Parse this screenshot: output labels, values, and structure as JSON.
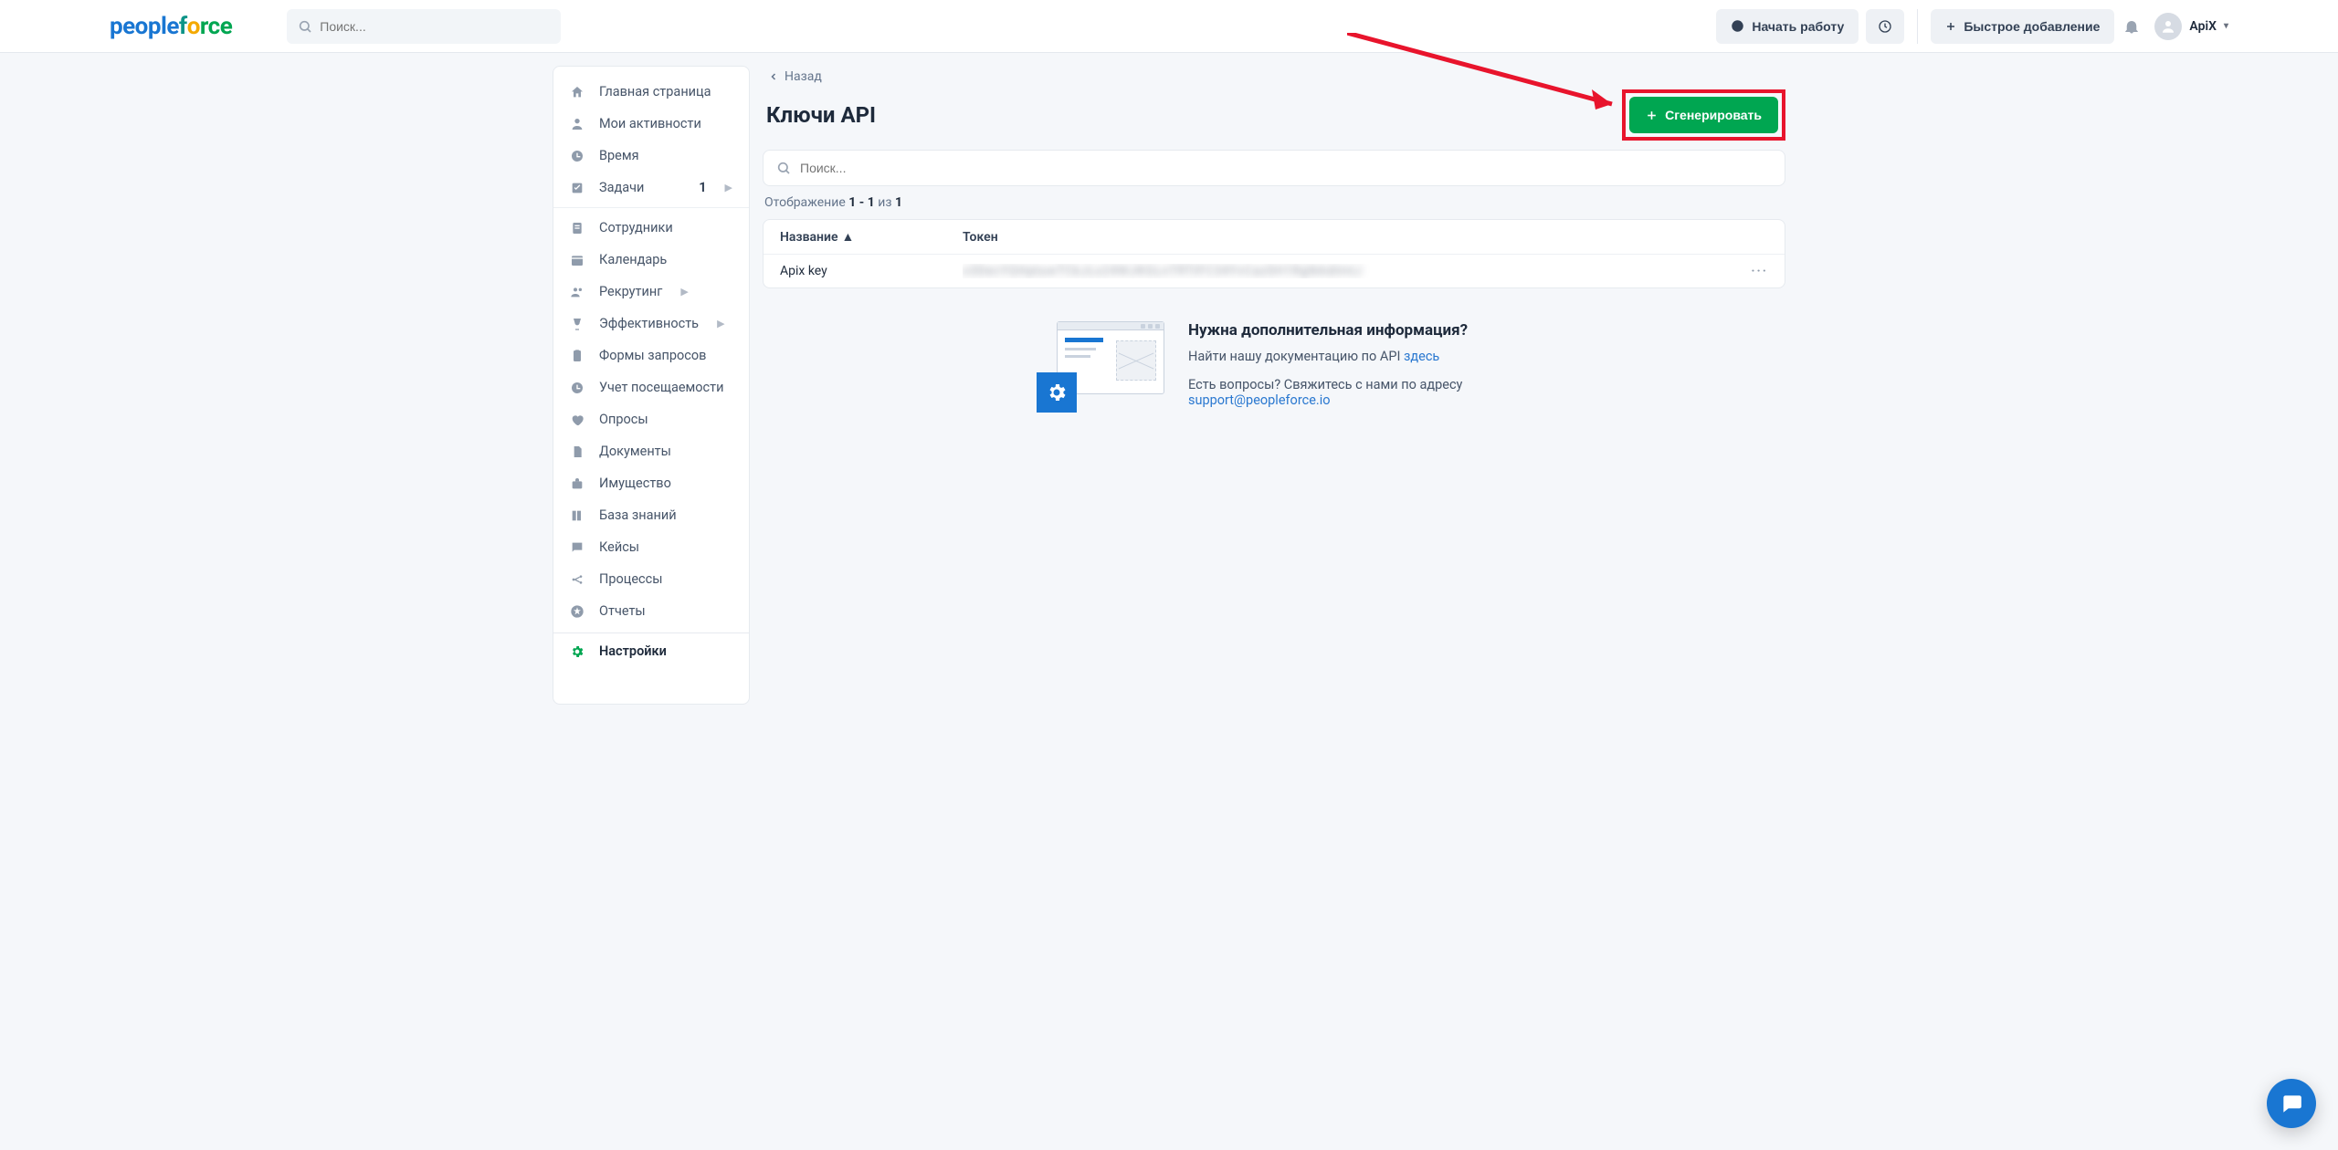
{
  "header": {
    "search_placeholder": "Поиск...",
    "start_work": "Начать работу",
    "quick_add": "Быстрое добавление",
    "user_name": "ApiX"
  },
  "sidebar": {
    "items": [
      {
        "label": "Главная страница"
      },
      {
        "label": "Мои активности"
      },
      {
        "label": "Время"
      },
      {
        "label": "Задачи",
        "badge": "1",
        "chevron": true
      },
      {
        "label": "Сотрудники"
      },
      {
        "label": "Календарь"
      },
      {
        "label": "Рекрутинг",
        "chevron": true
      },
      {
        "label": "Эффективность",
        "chevron": true
      },
      {
        "label": "Формы запросов"
      },
      {
        "label": "Учет посещаемости"
      },
      {
        "label": "Опросы"
      },
      {
        "label": "Документы"
      },
      {
        "label": "Имущество"
      },
      {
        "label": "База знаний"
      },
      {
        "label": "Кейсы"
      },
      {
        "label": "Процессы"
      },
      {
        "label": "Отчеты"
      },
      {
        "label": "Настройки",
        "active": true
      }
    ]
  },
  "page": {
    "back": "Назад",
    "title": "Ключи API",
    "generate": "Сгенерировать",
    "search_placeholder": "Поиск...",
    "count_prefix": "Отображение",
    "count_range": "1 - 1",
    "count_of": "из",
    "count_total": "1",
    "columns": {
      "name": "Название",
      "token": "Токен"
    },
    "rows": [
      {
        "name": "Apix key",
        "token": "x3DecYQHptuwTCkJLx24WJKGLnTRTtFC34YvCazSH1RgNAdImtJ"
      }
    ],
    "info": {
      "heading": "Нужна дополнительная информация?",
      "line1_prefix": "Найти нашу документацию по API ",
      "line1_link": "здесь",
      "line2_prefix": "Есть вопросы? Свяжитесь с нами по адресу ",
      "email": "support@peopleforce.io"
    }
  }
}
